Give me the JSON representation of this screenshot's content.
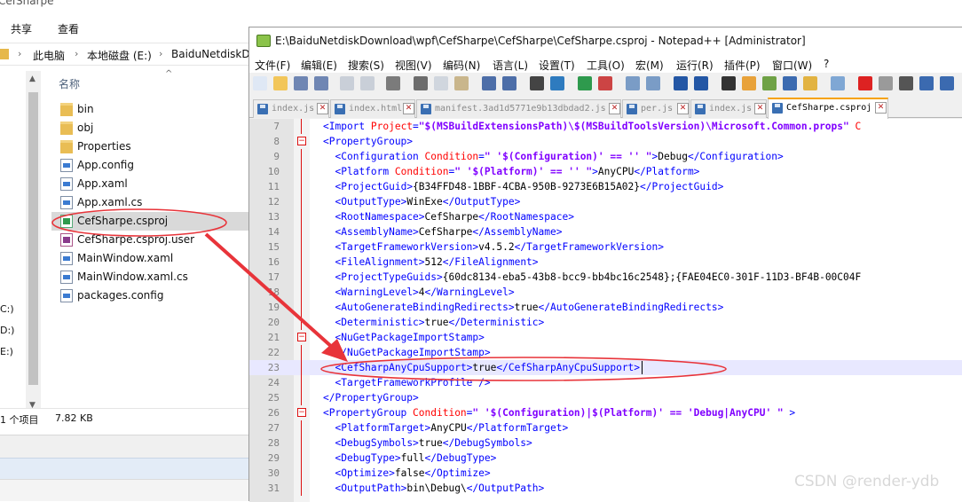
{
  "explorer": {
    "title": "CefSharpe",
    "ribbon": {
      "share": "共享",
      "view": "查看"
    },
    "address": {
      "this_pc": "此电脑",
      "drive": "本地磁盘 (E:)",
      "folder": "BaiduNetdiskD"
    },
    "nav_drives": [
      "C:)",
      "D:)",
      "E:)"
    ],
    "column_name": "名称",
    "files": [
      {
        "name": "bin",
        "icon": "folder-icon"
      },
      {
        "name": "obj",
        "icon": "folder-icon"
      },
      {
        "name": "Properties",
        "icon": "folder-icon"
      },
      {
        "name": "App.config",
        "icon": "config-file-icon"
      },
      {
        "name": "App.xaml",
        "icon": "xaml-file-icon"
      },
      {
        "name": "App.xaml.cs",
        "icon": "cs-file-icon"
      },
      {
        "name": "CefSharpe.csproj",
        "icon": "csproj-file-icon",
        "selected": true
      },
      {
        "name": "CefSharpe.csproj.user",
        "icon": "user-file-icon"
      },
      {
        "name": "MainWindow.xaml",
        "icon": "xaml-file-icon"
      },
      {
        "name": "MainWindow.xaml.cs",
        "icon": "cs-file-icon"
      },
      {
        "name": "packages.config",
        "icon": "config-file-icon"
      }
    ],
    "status": {
      "selected": "1 个项目",
      "size": "7.82 KB"
    }
  },
  "notepad": {
    "title": "E:\\BaiduNetdiskDownload\\wpf\\CefSharpe\\CefSharpe\\CefSharpe.csproj - Notepad++ [Administrator]",
    "menu": [
      "文件(F)",
      "编辑(E)",
      "搜索(S)",
      "视图(V)",
      "编码(N)",
      "语言(L)",
      "设置(T)",
      "工具(O)",
      "宏(M)",
      "运行(R)",
      "插件(P)",
      "窗口(W)",
      "?"
    ],
    "tabs": [
      {
        "label": "index.js",
        "active": false
      },
      {
        "label": "index.html",
        "active": false
      },
      {
        "label": "manifest.3ad1d5771e9b13dbdad2.js",
        "active": false
      },
      {
        "label": "per.js",
        "active": false
      },
      {
        "label": "index.js",
        "active": false
      },
      {
        "label": "CefSharpe.csproj",
        "active": true
      }
    ],
    "lines": [
      {
        "n": "7",
        "indent": 1,
        "segs": [
          [
            "t",
            "<Import "
          ],
          [
            "a",
            "Project"
          ],
          [
            "t",
            "="
          ],
          [
            "v",
            "\"$(MSBuildExtensionsPath)\\$(MSBuildToolsVersion)\\Microsoft.Common.props\""
          ],
          [
            "a",
            " C"
          ]
        ]
      },
      {
        "n": "8",
        "indent": 1,
        "fold": "open",
        "segs": [
          [
            "t",
            "<PropertyGroup>"
          ]
        ]
      },
      {
        "n": "9",
        "indent": 2,
        "segs": [
          [
            "t",
            "<Configuration "
          ],
          [
            "a",
            "Condition"
          ],
          [
            "t",
            "="
          ],
          [
            "v",
            "\" '$(Configuration)' == '' \""
          ],
          [
            "t",
            ">"
          ],
          [
            "x",
            "Debug"
          ],
          [
            "t",
            "</Configuration>"
          ]
        ]
      },
      {
        "n": "10",
        "indent": 2,
        "segs": [
          [
            "t",
            "<Platform "
          ],
          [
            "a",
            "Condition"
          ],
          [
            "t",
            "="
          ],
          [
            "v",
            "\" '$(Platform)' == '' \""
          ],
          [
            "t",
            ">"
          ],
          [
            "x",
            "AnyCPU"
          ],
          [
            "t",
            "</Platform>"
          ]
        ]
      },
      {
        "n": "11",
        "indent": 2,
        "segs": [
          [
            "t",
            "<ProjectGuid>"
          ],
          [
            "x",
            "{B34FFD48-1BBF-4CBA-950B-9273E6B15A02}"
          ],
          [
            "t",
            "</ProjectGuid>"
          ]
        ]
      },
      {
        "n": "12",
        "indent": 2,
        "segs": [
          [
            "t",
            "<OutputType>"
          ],
          [
            "x",
            "WinExe"
          ],
          [
            "t",
            "</OutputType>"
          ]
        ]
      },
      {
        "n": "13",
        "indent": 2,
        "segs": [
          [
            "t",
            "<RootNamespace>"
          ],
          [
            "x",
            "CefSharpe"
          ],
          [
            "t",
            "</RootNamespace>"
          ]
        ]
      },
      {
        "n": "14",
        "indent": 2,
        "segs": [
          [
            "t",
            "<AssemblyName>"
          ],
          [
            "x",
            "CefSharpe"
          ],
          [
            "t",
            "</AssemblyName>"
          ]
        ]
      },
      {
        "n": "15",
        "indent": 2,
        "segs": [
          [
            "t",
            "<TargetFrameworkVersion>"
          ],
          [
            "x",
            "v4.5.2"
          ],
          [
            "t",
            "</TargetFrameworkVersion>"
          ]
        ]
      },
      {
        "n": "16",
        "indent": 2,
        "segs": [
          [
            "t",
            "<FileAlignment>"
          ],
          [
            "x",
            "512"
          ],
          [
            "t",
            "</FileAlignment>"
          ]
        ]
      },
      {
        "n": "17",
        "indent": 2,
        "segs": [
          [
            "t",
            "<ProjectTypeGuids>"
          ],
          [
            "x",
            "{60dc8134-eba5-43b8-bcc9-bb4bc16c2548};{FAE04EC0-301F-11D3-BF4B-00C04F"
          ]
        ]
      },
      {
        "n": "18",
        "indent": 2,
        "segs": [
          [
            "t",
            "<WarningLevel>"
          ],
          [
            "x",
            "4"
          ],
          [
            "t",
            "</WarningLevel>"
          ]
        ]
      },
      {
        "n": "19",
        "indent": 2,
        "segs": [
          [
            "t",
            "<AutoGenerateBindingRedirects>"
          ],
          [
            "x",
            "true"
          ],
          [
            "t",
            "</AutoGenerateBindingRedirects>"
          ]
        ]
      },
      {
        "n": "20",
        "indent": 2,
        "segs": [
          [
            "t",
            "<Deterministic>"
          ],
          [
            "x",
            "true"
          ],
          [
            "t",
            "</Deterministic>"
          ]
        ]
      },
      {
        "n": "21",
        "indent": 2,
        "fold": "open",
        "segs": [
          [
            "t",
            "<NuGetPackageImportStamp>"
          ]
        ]
      },
      {
        "n": "22",
        "indent": 2,
        "segs": [
          [
            "t",
            "</NuGetPackageImportStamp>"
          ]
        ]
      },
      {
        "n": "23",
        "indent": 2,
        "current": true,
        "segs": [
          [
            "t",
            "<CefSharpAnyCpuSupport>"
          ],
          [
            "x",
            "true"
          ],
          [
            "t",
            "</CefSharpAnyCpuSupport>"
          ]
        ]
      },
      {
        "n": "24",
        "indent": 2,
        "segs": [
          [
            "t",
            "<TargetFrameworkProfile />"
          ]
        ]
      },
      {
        "n": "25",
        "indent": 1,
        "segs": [
          [
            "t",
            "</PropertyGroup>"
          ]
        ]
      },
      {
        "n": "26",
        "indent": 1,
        "fold": "open",
        "segs": [
          [
            "t",
            "<PropertyGroup "
          ],
          [
            "a",
            "Condition"
          ],
          [
            "t",
            "="
          ],
          [
            "v",
            "\" '$(Configuration)|$(Platform)' == 'Debug|AnyCPU' \""
          ],
          [
            "t",
            " >"
          ]
        ]
      },
      {
        "n": "27",
        "indent": 2,
        "segs": [
          [
            "t",
            "<PlatformTarget>"
          ],
          [
            "x",
            "AnyCPU"
          ],
          [
            "t",
            "</PlatformTarget>"
          ]
        ]
      },
      {
        "n": "28",
        "indent": 2,
        "segs": [
          [
            "t",
            "<DebugSymbols>"
          ],
          [
            "x",
            "true"
          ],
          [
            "t",
            "</DebugSymbols>"
          ]
        ]
      },
      {
        "n": "29",
        "indent": 2,
        "segs": [
          [
            "t",
            "<DebugType>"
          ],
          [
            "x",
            "full"
          ],
          [
            "t",
            "</DebugType>"
          ]
        ]
      },
      {
        "n": "30",
        "indent": 2,
        "segs": [
          [
            "t",
            "<Optimize>"
          ],
          [
            "x",
            "false"
          ],
          [
            "t",
            "</Optimize>"
          ]
        ]
      },
      {
        "n": "31",
        "indent": 2,
        "segs": [
          [
            "t",
            "<OutputPath>"
          ],
          [
            "x",
            "bin\\Debug\\"
          ],
          [
            "t",
            "</OutputPath>"
          ]
        ]
      }
    ]
  },
  "colors": {
    "annotation": "#e8343a",
    "current_line": "#e8e8ff",
    "tag": "#0000ff",
    "attr": "#ff0000",
    "value": "#8000ff",
    "active_tab_accent": "#f6a200"
  },
  "watermark": "CSDN @render-ydb"
}
